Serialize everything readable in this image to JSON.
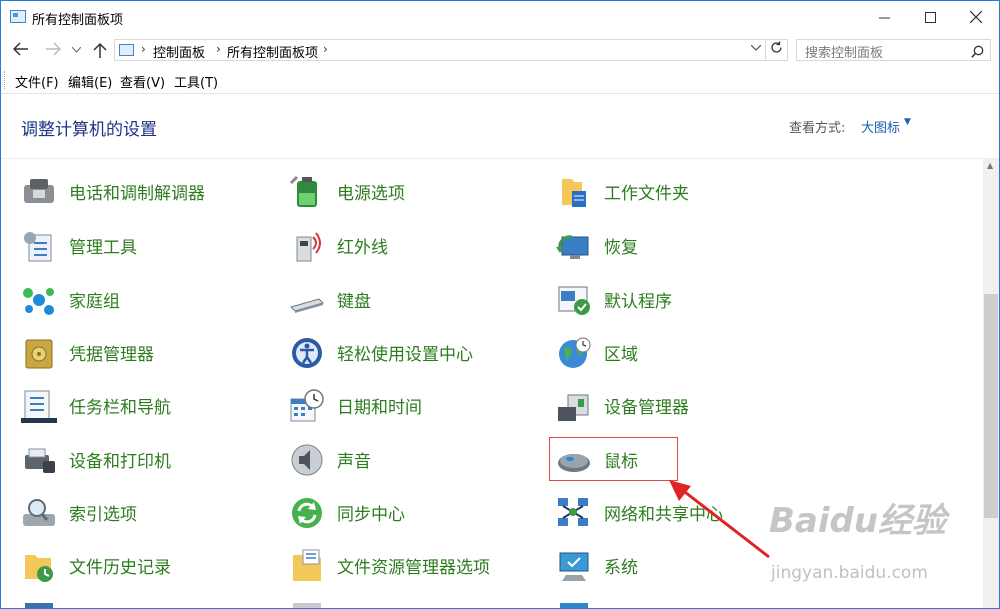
{
  "window": {
    "title": "所有控制面板项"
  },
  "address": {
    "crumbs": [
      "控制面板",
      "所有控制面板项"
    ],
    "search_placeholder": "搜索控制面板"
  },
  "menubar": [
    "文件(F)",
    "编辑(E)",
    "查看(V)",
    "工具(T)"
  ],
  "header": {
    "title": "调整计算机的设置",
    "viewby_label": "查看方式:",
    "viewby_value": "大图标"
  },
  "items": {
    "c1": [
      "电话和调制解调器",
      "管理工具",
      "家庭组",
      "凭据管理器",
      "任务栏和导航",
      "设备和打印机",
      "索引选项",
      "文件历史记录"
    ],
    "c2": [
      "电源选项",
      "红外线",
      "键盘",
      "轻松使用设置中心",
      "日期和时间",
      "声音",
      "同步中心",
      "文件资源管理器选项"
    ],
    "c3": [
      "工作文件夹",
      "恢复",
      "默认程序",
      "区域",
      "设备管理器",
      "鼠标",
      "网络和共享中心",
      "系统"
    ]
  },
  "highlighted_item": "鼠标",
  "watermark": {
    "logo": "Baidu经验",
    "url": "jingyan.baidu.com"
  },
  "colors": {
    "item_label": "#2d7d1f",
    "title": "#1e3287",
    "link": "#1a5fb4",
    "highlight": "#e04848"
  }
}
